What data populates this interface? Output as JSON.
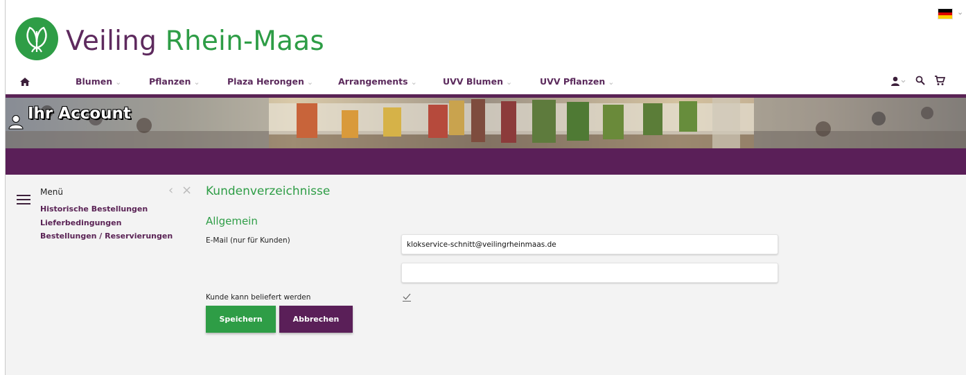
{
  "brand": {
    "name_part1": "Veiling",
    "name_part2": "Rhein-Maas"
  },
  "colors": {
    "brand_purple": "#5a2355",
    "brand_green": "#2e9d46",
    "content_bg": "#f3f3f3"
  },
  "language": {
    "selected": "de",
    "flag_icon": "flag-germany-icon"
  },
  "nav": {
    "home_icon": "home-icon",
    "items": [
      {
        "label": "Blumen"
      },
      {
        "label": "Pflanzen"
      },
      {
        "label": "Plaza Herongen"
      },
      {
        "label": "Arrangements"
      },
      {
        "label": "UVV Blumen"
      },
      {
        "label": "UVV Pflanzen"
      }
    ],
    "right_icons": [
      "user-icon",
      "search-icon",
      "cart-icon"
    ]
  },
  "banner": {
    "title": "Ihr Account",
    "icon": "user-icon"
  },
  "sidebar": {
    "title": "Menü",
    "links": [
      {
        "label": "Historische Bestellungen"
      },
      {
        "label": "Lieferbedingungen"
      },
      {
        "label": "Bestellungen / Reservierungen"
      }
    ]
  },
  "main": {
    "title": "Kundenverzeichnisse",
    "section": "Allgemein",
    "email_label": "E-Mail (nur für Kunden)",
    "email_value": "klokservice-schnitt@veilingrheinmaas.de",
    "email2_value": "",
    "delivery_label": "Kunde kann beliefert werden",
    "delivery_checked": true,
    "save_label": "Speichern",
    "cancel_label": "Abbrechen"
  }
}
